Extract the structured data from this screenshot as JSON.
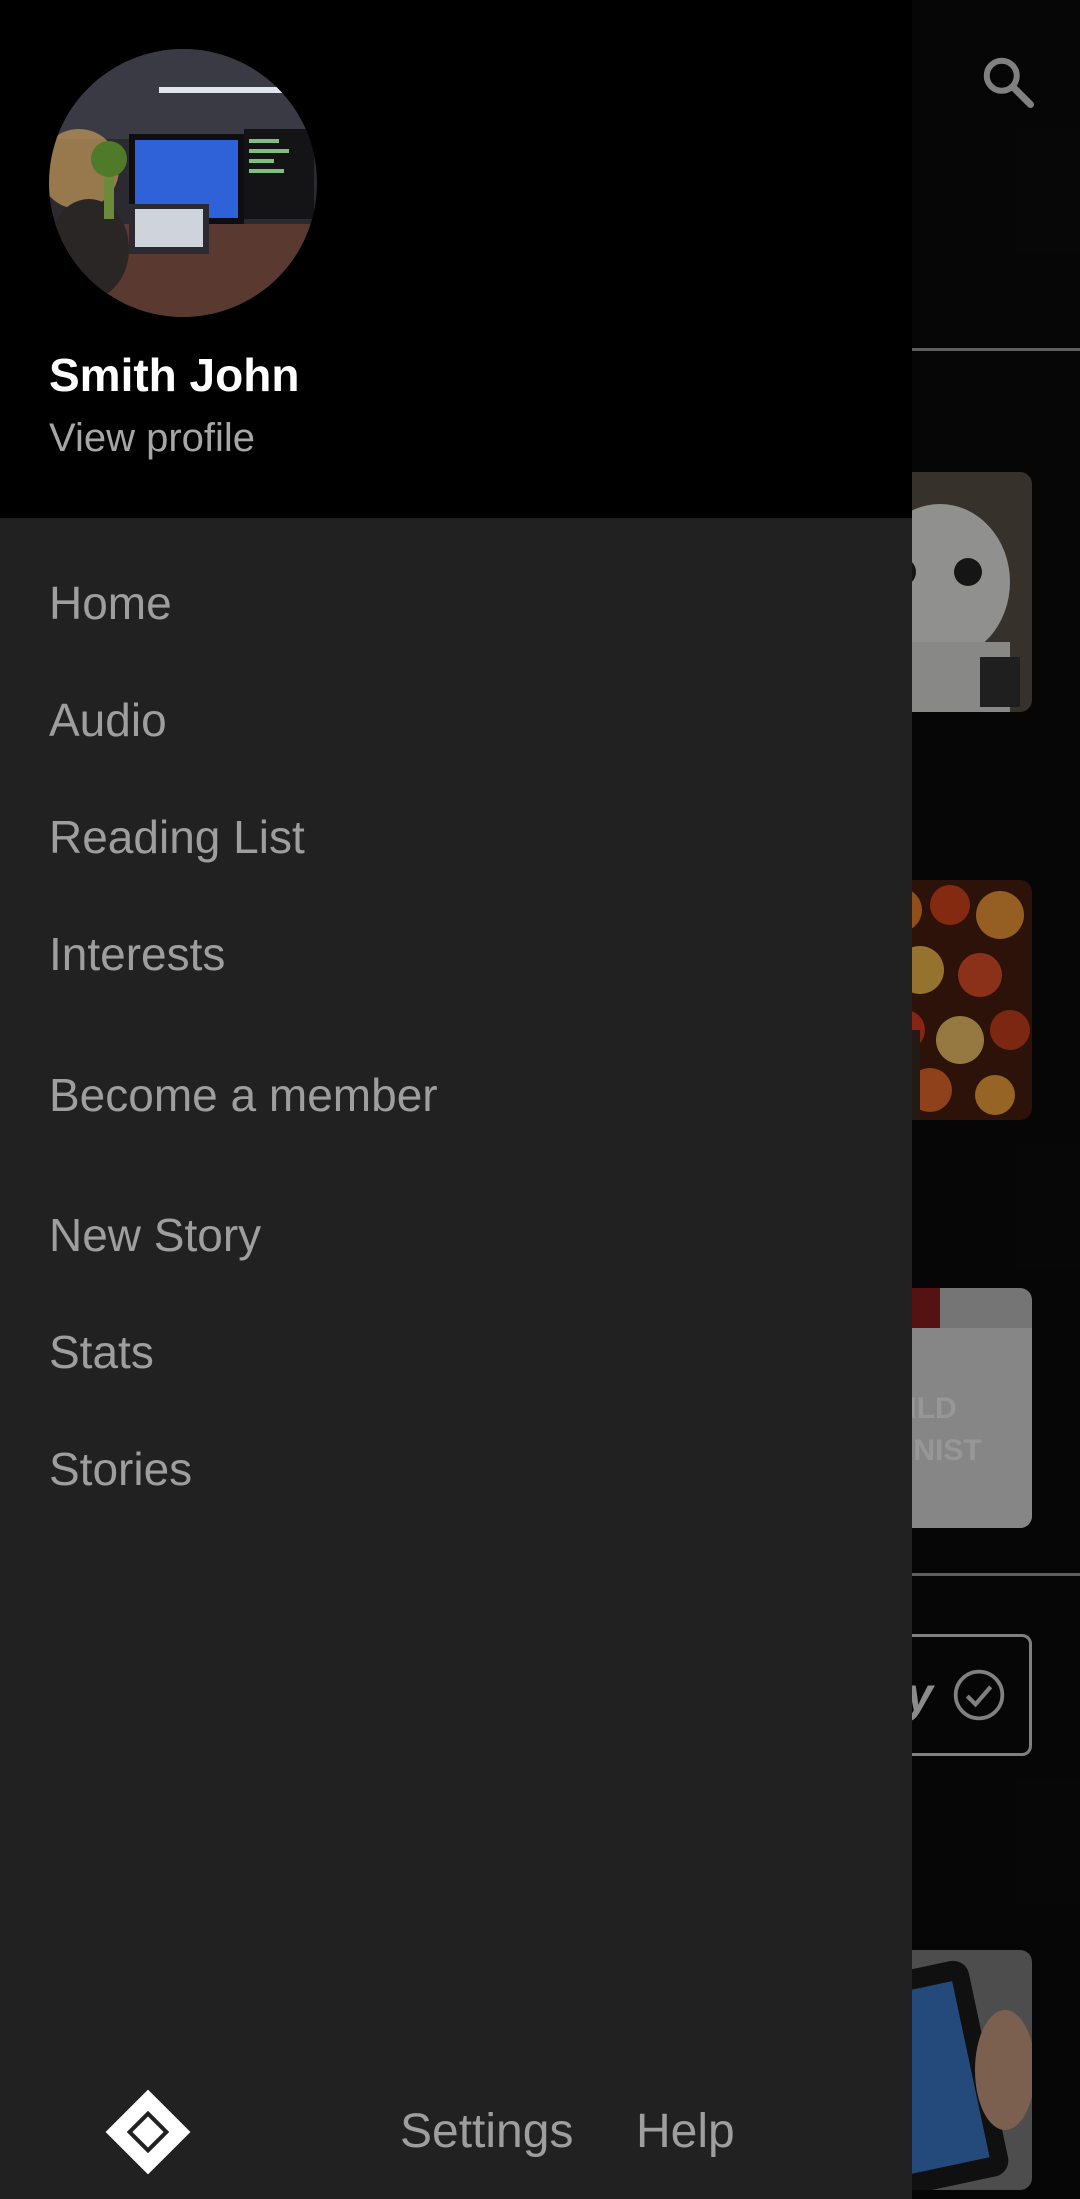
{
  "drawer": {
    "user": {
      "name": "Smith John",
      "view_profile_label": "View profile",
      "avatar_icon": "workspace-photo"
    },
    "nav_items": [
      {
        "label": "Home"
      },
      {
        "label": "Audio"
      },
      {
        "label": "Reading List"
      },
      {
        "label": "Interests"
      },
      {
        "label": "Become a member"
      },
      {
        "label": "New Story"
      },
      {
        "label": "Stats"
      },
      {
        "label": "Stories"
      }
    ],
    "footer": {
      "logo_icon": "diamond-logo-icon",
      "settings_label": "Settings",
      "help_label": "Help"
    }
  },
  "background": {
    "search_icon": "search-icon",
    "button_partial_text": "y",
    "button_icon": "check-circle-icon",
    "thumbnails": [
      "robot-thumbnail",
      "lanterns-thumbnail",
      "shirt-thumbnail",
      "phone-thumbnail"
    ]
  },
  "colors": {
    "drawer_bg": "#212121",
    "header_bg": "#000000",
    "nav_text": "#9e9e9e",
    "name_text": "#ffffff"
  }
}
